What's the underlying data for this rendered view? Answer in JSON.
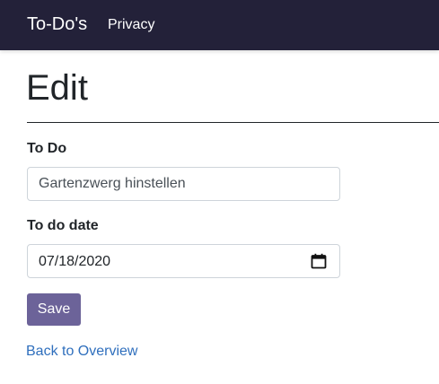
{
  "navbar": {
    "brand": "To-Do's",
    "links": [
      {
        "label": "Privacy"
      }
    ]
  },
  "page": {
    "title": "Edit"
  },
  "form": {
    "todo": {
      "label": "To Do",
      "value": "Gartenzwerg hinstellen"
    },
    "date": {
      "label": "To do date",
      "value": "07/18/2020",
      "icon": "calendar-icon"
    },
    "save_label": "Save"
  },
  "back_link": "Back to Overview",
  "colors": {
    "navbar_bg": "#232139",
    "button_bg": "#6c6399",
    "link": "#2f6fbd"
  }
}
